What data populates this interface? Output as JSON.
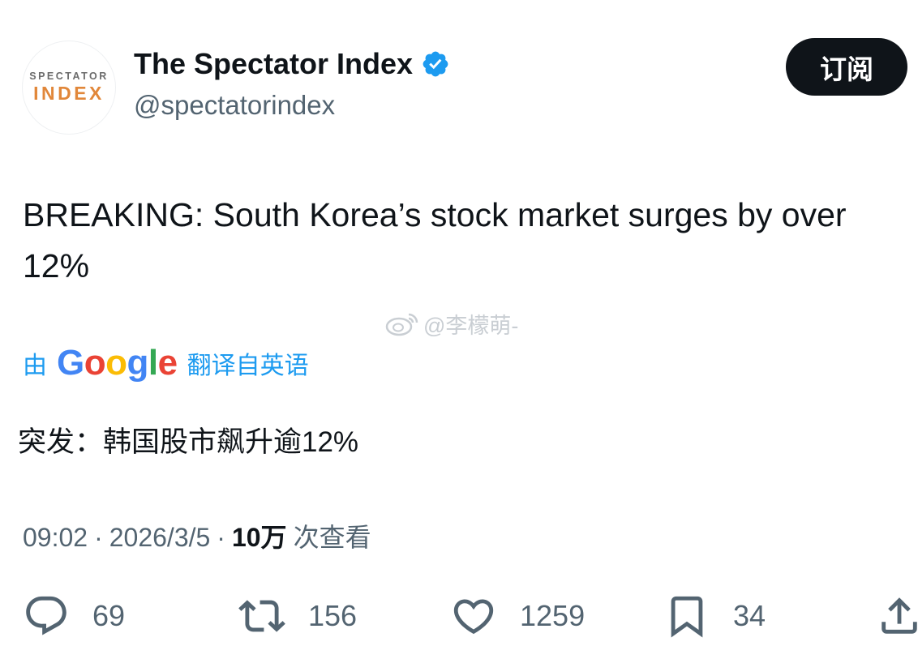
{
  "account": {
    "avatar_top": "SPECTATOR",
    "avatar_bottom": "INDEX",
    "name": "The Spectator Index",
    "handle": "@spectatorindex",
    "verified_icon": "verified-badge-icon",
    "verified_color": "#1d9bf0"
  },
  "subscribe_label": "订阅",
  "tweet": {
    "text": "BREAKING: South Korea’s stock market surges by over 12%"
  },
  "watermark": {
    "text": "@李檬萌-",
    "icon": "weibo-icon"
  },
  "translation": {
    "prefix": "由",
    "provider": [
      "G",
      "o",
      "o",
      "g",
      "l",
      "e"
    ],
    "provider_colors": [
      "#4285F4",
      "#EA4335",
      "#FBBC05",
      "#4285F4",
      "#34A853",
      "#EA4335"
    ],
    "suffix": "翻译自英语",
    "text": "突发：韩国股市飙升逾12%"
  },
  "meta": {
    "time": "09:02",
    "separator": "·",
    "date": "2026/3/5",
    "views_count": "10万",
    "views_label": "次查看"
  },
  "actions": {
    "replies": "69",
    "reposts": "156",
    "likes": "1259",
    "bookmarks": "34"
  },
  "colors": {
    "text": "#0f1419",
    "secondary": "#536471",
    "link": "#1d9bf0",
    "avatar_accent": "#e1873a"
  }
}
